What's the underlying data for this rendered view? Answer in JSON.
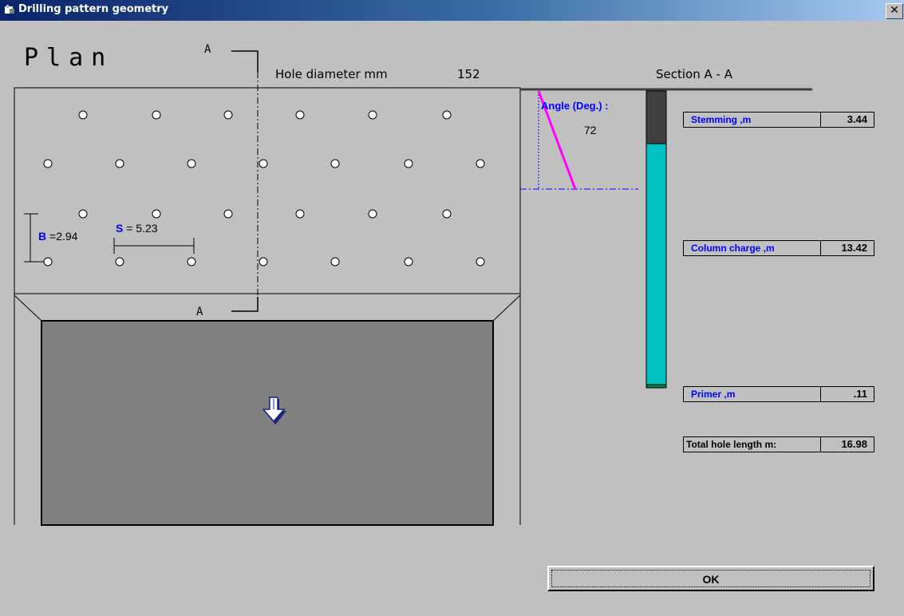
{
  "window": {
    "title": "Drilling pattern geometry",
    "close_glyph": "✕"
  },
  "plan": {
    "title": "Plan",
    "section_marker_top": "A",
    "section_marker_bottom": "A",
    "hole_diameter_label": "Hole diameter  mm",
    "hole_diameter_value": "152",
    "burden_name": "B",
    "burden_value": "=2.94",
    "spacing_name": "S",
    "spacing_value": "= 5.23"
  },
  "section": {
    "title": "Section  A - A",
    "angle_label": "Angle (Deg.) :",
    "angle_value": "72",
    "fields": [
      {
        "label": "Stemming ,m",
        "value": "3.44"
      },
      {
        "label": "Column charge ,m",
        "value": "13.42"
      },
      {
        "label": "Primer ,m",
        "value": ".11"
      },
      {
        "label": "Total hole length m:",
        "value": "16.98"
      }
    ]
  },
  "buttons": {
    "ok_label": "OK"
  },
  "colors": {
    "stemming": "#404040",
    "charge": "#00c0c0",
    "primer": "#008040",
    "angle_line": "#ff00ff",
    "field_label": "#0000ff",
    "viewport": "#808080",
    "arrow": "#1a237e"
  },
  "icons": {
    "title": "app-icon",
    "arrow": "down-arrow-icon",
    "close": "close-icon"
  }
}
